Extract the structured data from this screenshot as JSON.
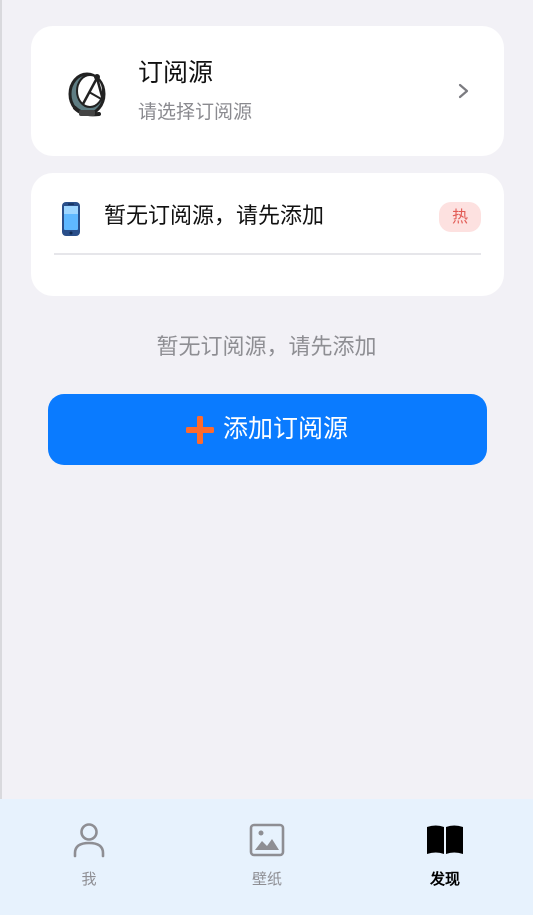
{
  "source_card": {
    "icon": "satellite-dish-icon",
    "title": "订阅源",
    "subtitle": "请选择订阅源",
    "chevron": "chevron-right-icon"
  },
  "list_card": {
    "icon": "smartphone-icon",
    "text": "暂无订阅源，请先添加",
    "badge": "热"
  },
  "empty_message": "暂无订阅源，请先添加",
  "add_button": {
    "icon": "plus-icon",
    "label": "添加订阅源"
  },
  "tabbar": {
    "active": "discover",
    "tabs": [
      {
        "id": "me",
        "label": "我",
        "icon": "person-icon"
      },
      {
        "id": "wallpaper",
        "label": "壁纸",
        "icon": "image-icon"
      },
      {
        "id": "discover",
        "label": "发现",
        "icon": "open-book-icon"
      }
    ]
  },
  "colors": {
    "background": "#f2f1f6",
    "card": "#ffffff",
    "primary": "#0a7bff",
    "plus_icon": "#ff6a2c",
    "badge_bg": "#fde1e0",
    "badge_text": "#e25b55",
    "secondary_text": "#8e8e93",
    "tabbar_bg": "#e7f2fd"
  }
}
